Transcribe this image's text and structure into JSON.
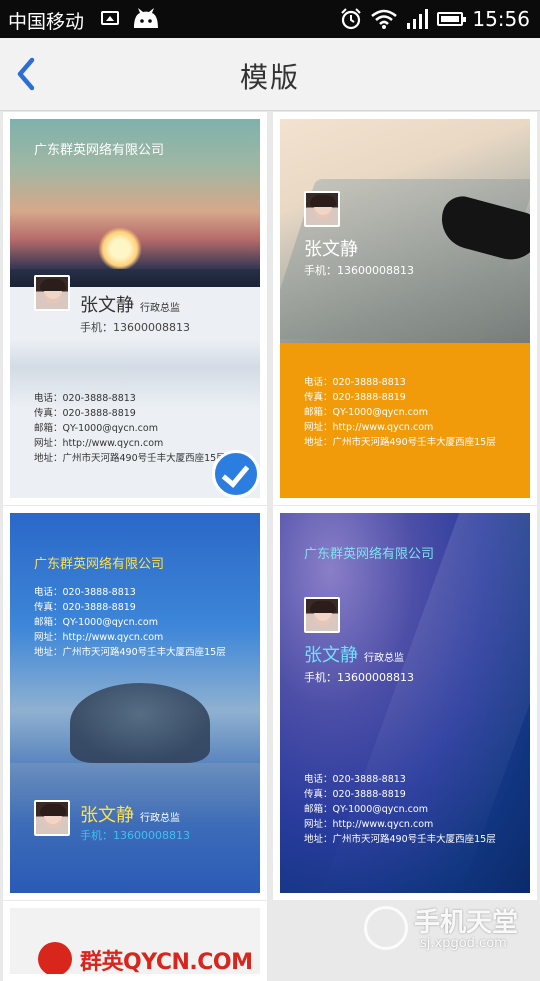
{
  "status_bar": {
    "carrier": "中国移动",
    "time": "15:56",
    "icons": [
      "image-icon",
      "cat-icon",
      "alarm-icon",
      "wifi-icon",
      "signal-icon",
      "battery-icon"
    ]
  },
  "header": {
    "title": "模版",
    "back_icon": "chevron-left-icon",
    "accent": "#2b6fd6"
  },
  "templates": [
    {
      "company": "广东群英网络有限公司",
      "name": "张文静",
      "role": "行政总监",
      "mobile": "手机：13600008813",
      "info": [
        "电话：020-3888-8813",
        "传真：020-3888-8819",
        "邮箱：QY-1000@qycn.com",
        "网址：http://www.qycn.com",
        "地址：广州市天河路490号壬丰大厦西座15层"
      ],
      "selected": true
    },
    {
      "company": "",
      "name": "张文静",
      "role": "",
      "mobile": "手机：13600008813",
      "info": [
        "电话：020-3888-8813",
        "传真：020-3888-8819",
        "邮箱：QY-1000@qycn.com",
        "网址：http://www.qycn.com",
        "地址：广州市天河路490号壬丰大厦西座15层"
      ],
      "selected": false,
      "accent": "#f19b0b"
    },
    {
      "company": "广东群英网络有限公司",
      "name": "张文静",
      "role": "行政总监",
      "mobile": "手机：13600008813",
      "info": [
        "电话：020-3888-8813",
        "传真：020-3888-8819",
        "邮箱：QY-1000@qycn.com",
        "网址：http://www.qycn.com",
        "地址：广州市天河路490号壬丰大厦西座15层"
      ],
      "selected": false
    },
    {
      "company": "广东群英网络有限公司",
      "name": "张文静",
      "role": "行政总监",
      "mobile": "手机：13600008813",
      "info": [
        "电话：020-3888-8813",
        "传真：020-3888-8819",
        "邮箱：QY-1000@qycn.com",
        "网址：http://www.qycn.com",
        "地址：广州市天河路490号壬丰大厦西座15层"
      ],
      "selected": false
    },
    {
      "logo_text": "群英QYCN.COM"
    }
  ],
  "watermark": {
    "title": "手机天堂",
    "url": "sj.xpgod.com"
  }
}
